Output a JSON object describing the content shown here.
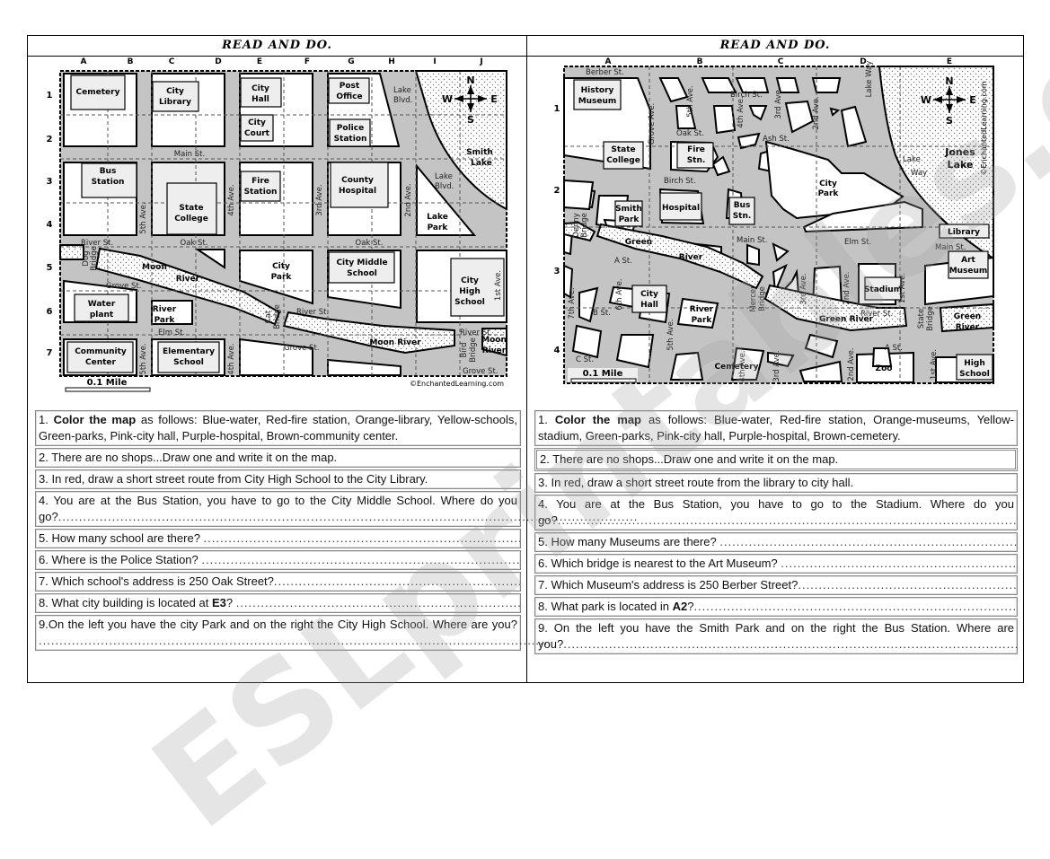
{
  "left": {
    "title": "READ AND DO.",
    "columns": [
      "A",
      "B",
      "C",
      "D",
      "E",
      "F",
      "G",
      "H",
      "I",
      "J"
    ],
    "rows": [
      "1",
      "2",
      "3",
      "4",
      "5",
      "6",
      "7"
    ],
    "map": {
      "buildings": {
        "cemetery": "Cemetery",
        "city_library": [
          "City",
          "Library"
        ],
        "city_hall": [
          "City",
          "Hall"
        ],
        "city_court": [
          "City",
          "Court"
        ],
        "post_office": [
          "Post",
          "Office"
        ],
        "police_station": [
          "Police",
          "Station"
        ],
        "bus_station": [
          "Bus",
          "Station"
        ],
        "state_college": [
          "State",
          "College"
        ],
        "fire_station": [
          "Fire",
          "Station"
        ],
        "county_hospital": [
          "County",
          "Hospital"
        ],
        "lake_park": [
          "Lake",
          "Park"
        ],
        "city_park": [
          "City",
          "Park"
        ],
        "city_middle_school": [
          "City Middle",
          "School"
        ],
        "city_high_school": [
          "City",
          "High",
          "School"
        ],
        "water_plant": [
          "Water",
          "plant"
        ],
        "river_park": [
          "River",
          "Park"
        ],
        "community_center": [
          "Community",
          "Center"
        ],
        "elementary_school": [
          "Elementary",
          "School"
        ]
      },
      "streets": {
        "main": "Main St.",
        "oak": "Oak St.",
        "river_w": "River St.",
        "river_e": "River St.",
        "river_far": "River St.",
        "grove_w": "Grove St.",
        "grove_e": "Grove St.",
        "grove_far": "Grove St.",
        "elm": "Elm St.",
        "ave5": "5th Ave.",
        "ave5b": "5th Ave.",
        "ave4": "4th Ave.",
        "ave4b": "4th Ave.",
        "ave3": "3rd Ave.",
        "ave2": "2nd Ave.",
        "ave1": "1st Ave.",
        "lake_blvd_1": [
          "Lake",
          "Blvd."
        ],
        "lake_blvd_2": [
          "Lake",
          "Blvd."
        ]
      },
      "water": {
        "lake": [
          "Smith",
          "Lake"
        ],
        "moon_river_1": "Moon",
        "moon_river_2": "River",
        "moon_river_3": "Moon River",
        "moon_river_4": [
          "Moon",
          "River"
        ]
      },
      "bridges": {
        "dog": [
          "Dog",
          "Bridge"
        ],
        "cat": [
          "Cat",
          "Bridge"
        ],
        "bird": [
          "Bird",
          "Bridge"
        ]
      },
      "compass": {
        "n": "N",
        "s": "S",
        "e": "E",
        "w": "W"
      },
      "scale": "0.1 Mile",
      "credit": "©EnchantedLearning.com"
    },
    "questions": [
      {
        "num": "1.",
        "bold": "Color the map",
        "text": " as follows: Blue-water, Red-fire station, Orange-library, Yellow-schools, Green-parks, Pink-city hall, Purple-hospital, Brown-community center."
      },
      {
        "text": "2. There are no shops...Draw one and write it on the map."
      },
      {
        "text": "3. In red, draw a short street route from City High School to the City Library."
      },
      {
        "text": "4. You are at the Bus Station, you have to go to the City Middle School. Where do you go?",
        "dots": "............................................................................................................................................"
      },
      {
        "text": "5. How many school are there? ",
        "dots": "..............................................................................................."
      },
      {
        "text": "6. Where is the Police Station? ",
        "dots": "..................................................................................................."
      },
      {
        "text": "7. Which school's address is 250 Oak Street?",
        "dots": "......................................................................................"
      },
      {
        "pre": "8. What city building is located at ",
        "bold": "E3",
        "post": "? ",
        "dots": "..........................................................................."
      },
      {
        "text": "9.On the left you have the city Park and on the right the City High School. Where are you? ",
        "dots": "..........................................................................................................................."
      }
    ]
  },
  "right": {
    "title": "READ AND DO.",
    "columns": [
      "A",
      "B",
      "C",
      "D",
      "E"
    ],
    "rows": [
      "1",
      "2",
      "3",
      "4"
    ],
    "map": {
      "buildings": {
        "history_museum": [
          "History",
          "Museum"
        ],
        "state_college": [
          "State",
          "College"
        ],
        "fire_stn": [
          "Fire",
          "Stn."
        ],
        "smith_park": [
          "Smith",
          "Park"
        ],
        "hospital": "Hospital",
        "bus_stn": [
          "Bus",
          "Stn."
        ],
        "city_park": [
          "City",
          "Park"
        ],
        "library": "Library",
        "art_museum": [
          "Art",
          "Museum"
        ],
        "stadium": "Stadium",
        "city_hall": [
          "City",
          "Hall"
        ],
        "river_park": [
          "River",
          "Park"
        ],
        "cemetery": "Cemetery",
        "zoo": "Zoo",
        "high_school": [
          "High",
          "School"
        ]
      },
      "streets": {
        "berber": "Berber St.",
        "birch_n": "Birch St.",
        "birch": "Birch St.",
        "oak": "Oak St.",
        "ash": "Ash St.",
        "elm": "Elm St.",
        "main_w": "Main St.",
        "main_e": "Main St.",
        "river": "River St.",
        "a_st_w": "A St.",
        "a_st_e": "A St.",
        "b_st": "B St.",
        "c_st": "C St.",
        "grove": "Grove Ave.",
        "ave5": "5th Ave.",
        "ave5b": "5th Ave.",
        "ave4": "4th Ave.",
        "ave4b": "4th Ave.",
        "ave3": "3rd Ave.",
        "ave3b": "3rd Ave.",
        "ave3c": "3rd Ave.",
        "ave2": "2nd Ave.",
        "ave2b": "2nd Ave.",
        "ave2c": "2nd Ave.",
        "ave1": "1st Ave.",
        "ave1b": "1st Ave.",
        "ave6": "6th Ave.",
        "ave7": "7th Ave.",
        "lake_way_n": "Lake Way",
        "lake_way": [
          "Lake",
          "Way"
        ]
      },
      "water": {
        "lake": [
          "Jones",
          "Lake"
        ],
        "green_river_1": "Green",
        "green_river_2": "River",
        "green_river_3": "Green River",
        "green_river_4": [
          "Green",
          "River"
        ]
      },
      "bridges": {
        "denny": [
          "Denny",
          "Bridge"
        ],
        "mercer": [
          "Mercer",
          "Bridge"
        ],
        "state": [
          "State",
          "Bridge"
        ]
      },
      "compass": {
        "n": "N",
        "s": "S",
        "e": "E",
        "w": "W"
      },
      "scale": "0.1 Mile",
      "credit": "©EnchantedLearning.com"
    },
    "questions": [
      {
        "num": "1.",
        "bold": "Color the map",
        "text": " as follows: Blue-water, Red-fire station, Orange-museums, Yellow-stadium, Green-parks, Pink-city hall, Purple-hospital, Brown-cemetery."
      },
      {
        "text": "2. There are no shops...Draw one and write it on the map."
      },
      {
        "text": "3. In red, draw a short street route from the library to city hall."
      },
      {
        "text": "4. You are at the Bus Station, you have to go to the Stadium. Where do you go?",
        "dots": "............................................................................................................................................"
      },
      {
        "text": "5. How many Museums are there? ",
        "dots": "........................................................................................."
      },
      {
        "text": "6. Which bridge is nearest to the Art Museum? ",
        "dots": "..............................................................."
      },
      {
        "text": "7. Which Museum's address is 250 Berber Street?",
        "dots": "....................................................................................."
      },
      {
        "pre": "8. What park is located in ",
        "bold": "A2",
        "post": "?",
        "dots": "................................................................................................."
      },
      {
        "text": "9. On the left you have the Smith Park and on the right the Bus Station. Where are you?",
        "dots": "..........................................................................................................................................."
      }
    ]
  },
  "watermark": "ESLprintables.com"
}
